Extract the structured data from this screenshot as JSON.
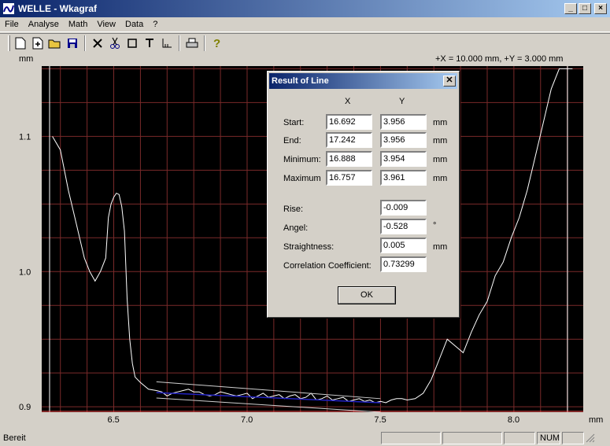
{
  "window": {
    "title": "WELLE - Wkagraf",
    "min": "_",
    "max": "□",
    "close": "×"
  },
  "menu": [
    "File",
    "Analyse",
    "Math",
    "View",
    "Data",
    "?"
  ],
  "chart": {
    "y_unit": "mm",
    "x_unit": "mm",
    "scale_info": "+X = 10.000 mm, +Y = 3.000 mm",
    "y_ticks": [
      "1.1",
      "1.0",
      "0.9"
    ],
    "x_ticks": [
      "6.5",
      "7.0",
      "7.5",
      "8.0"
    ]
  },
  "chart_data": {
    "type": "line",
    "xlabel": "mm",
    "ylabel": "mm",
    "xlim": [
      6.23,
      8.26
    ],
    "ylim": [
      0.896,
      1.152
    ],
    "grid": true,
    "series": [
      {
        "x": [
          6.27,
          6.3,
          6.33,
          6.36,
          6.39,
          6.41,
          6.43,
          6.45,
          6.47,
          6.48,
          6.49,
          6.5,
          6.51,
          6.52,
          6.53,
          6.54,
          6.55,
          6.56,
          6.57,
          6.58,
          6.6,
          6.63,
          6.66,
          6.68,
          6.7,
          6.72,
          6.74,
          6.76,
          6.78,
          6.8,
          6.82,
          6.84,
          6.86,
          6.88,
          6.9,
          6.92,
          6.94,
          6.96,
          6.98,
          7.0,
          7.02,
          7.04,
          7.06,
          7.08,
          7.1,
          7.12,
          7.14,
          7.16,
          7.18,
          7.2,
          7.22,
          7.24,
          7.26,
          7.28,
          7.3,
          7.32,
          7.34,
          7.36,
          7.38,
          7.4,
          7.42,
          7.44,
          7.46,
          7.48,
          7.5,
          7.52,
          7.54,
          7.56,
          7.58,
          7.6,
          7.63,
          7.66,
          7.69,
          7.72,
          7.75,
          7.78,
          7.81,
          7.84,
          7.87,
          7.9,
          7.93,
          7.96,
          7.99,
          8.02,
          8.05,
          8.08,
          8.11,
          8.14,
          8.17,
          8.2,
          8.22
        ],
        "y": [
          1.1,
          1.09,
          1.06,
          1.035,
          1.01,
          1.0,
          0.993,
          1.0,
          1.01,
          1.04,
          1.05,
          1.055,
          1.058,
          1.057,
          1.048,
          1.03,
          0.98,
          0.95,
          0.932,
          0.922,
          0.918,
          0.913,
          0.912,
          0.911,
          0.908,
          0.91,
          0.911,
          0.912,
          0.913,
          0.911,
          0.911,
          0.909,
          0.908,
          0.909,
          0.911,
          0.91,
          0.909,
          0.908,
          0.909,
          0.91,
          0.906,
          0.908,
          0.91,
          0.907,
          0.908,
          0.909,
          0.906,
          0.908,
          0.909,
          0.906,
          0.907,
          0.91,
          0.905,
          0.906,
          0.908,
          0.905,
          0.906,
          0.907,
          0.904,
          0.905,
          0.906,
          0.904,
          0.905,
          0.903,
          0.904,
          0.903,
          0.905,
          0.906,
          0.906,
          0.905,
          0.906,
          0.91,
          0.92,
          0.935,
          0.95,
          0.945,
          0.94,
          0.955,
          0.968,
          0.978,
          0.997,
          1.007,
          1.025,
          1.04,
          1.06,
          1.085,
          1.11,
          1.135,
          1.15,
          1.15,
          1.15
        ]
      }
    ]
  },
  "dialog": {
    "title": "Result of Line",
    "col_x": "X",
    "col_y": "Y",
    "rows": [
      {
        "label": "Start:",
        "x": "16.692",
        "y": "3.956",
        "unit": "mm"
      },
      {
        "label": "End:",
        "x": "17.242",
        "y": "3.956",
        "unit": "mm"
      },
      {
        "label": "Minimum:",
        "x": "16.888",
        "y": "3.954",
        "unit": "mm"
      },
      {
        "label": "Maximum",
        "x": "16.757",
        "y": "3.961",
        "unit": "mm"
      }
    ],
    "metrics": [
      {
        "label": "Rise:",
        "value": "-0.009",
        "unit": ""
      },
      {
        "label": "Angel:",
        "value": "-0.528",
        "unit": "°"
      },
      {
        "label": "Straightness:",
        "value": "0.005",
        "unit": "mm"
      },
      {
        "label": "Correlation Coefficient:",
        "value": "0.73299",
        "unit": ""
      }
    ],
    "ok": "OK"
  },
  "status": {
    "text": "Bereit",
    "num": "NUM"
  }
}
